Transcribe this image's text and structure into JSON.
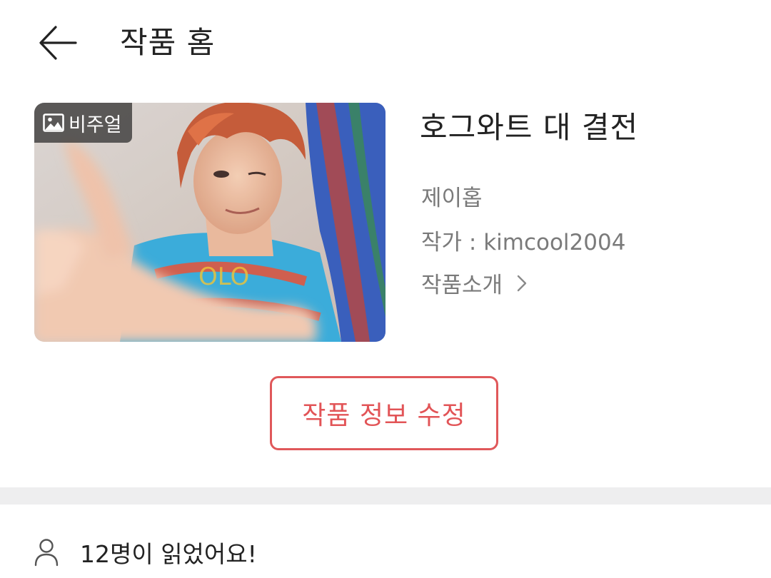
{
  "header": {
    "title": "작품 홈",
    "back_icon": "arrow-left-icon"
  },
  "work": {
    "cover_badge": "비주얼",
    "badge_icon": "image-icon",
    "title": "호그와트 대 결전",
    "subtitle": "제이홉",
    "author": "작가 : kimcool2004",
    "intro_link": "작품소개",
    "intro_icon": "chevron-right-icon"
  },
  "actions": {
    "edit_label": "작품 정보 수정",
    "accent_color": "#e25457"
  },
  "stats": {
    "readers_text": "12명이 읽었어요!",
    "icon": "person-icon"
  }
}
